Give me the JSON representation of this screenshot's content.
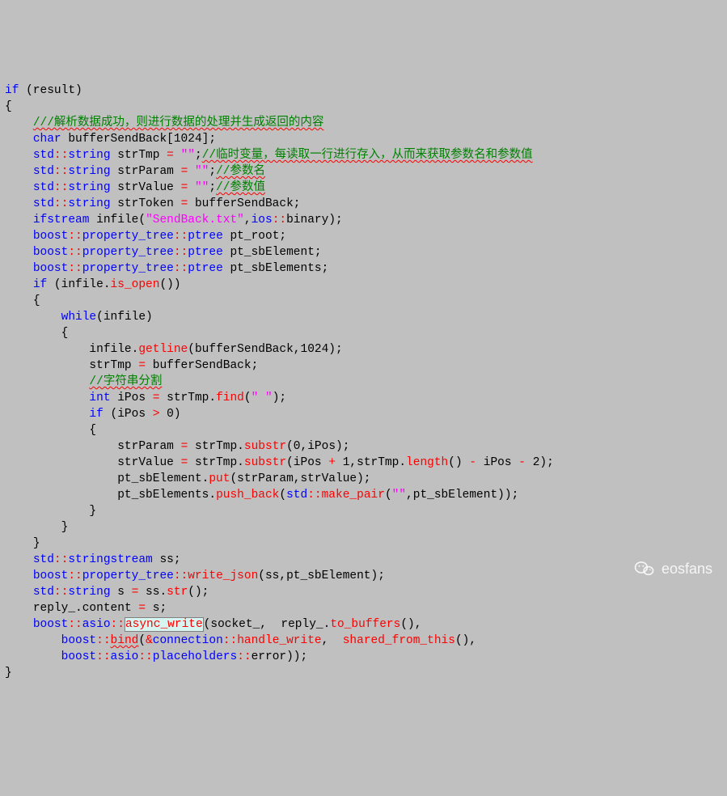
{
  "code": {
    "line1_if": "if",
    "line1_cond": " (result)",
    "line2_brace": "{",
    "line3_comment": "///解析数据成功，则进行数据的处理并生成返回的内容",
    "line4_char": "char",
    "line4_decl": " bufferSendBack[1024];",
    "line5_std": "std",
    "line5_dc1": "::",
    "line5_string": "string",
    "line5_var": " strTmp ",
    "line5_eq": "=",
    "line5_str": " \"\"",
    "line5_scolon": ";",
    "line5_comment": "//临时变量，每读取一行进行存入，从而来获取参数名和参数值",
    "line6_std": "std",
    "line6_dc1": "::",
    "line6_string": "string",
    "line6_var": " strParam ",
    "line6_eq": "=",
    "line6_str": " \"\"",
    "line6_scolon": ";",
    "line6_comment": "//参数名",
    "line7_std": "std",
    "line7_dc1": "::",
    "line7_string": "string",
    "line7_var": " strValue ",
    "line7_eq": "=",
    "line7_str": " \"\"",
    "line7_scolon": ";",
    "line7_comment": "//参数值",
    "line8_std": "std",
    "line8_dc1": "::",
    "line8_string": "string",
    "line8_var": " strToken ",
    "line8_eq": "=",
    "line8_rhs": " bufferSendBack;",
    "line9_ifstream": "ifstream",
    "line9_infile": " infile(",
    "line9_str": "\"SendBack.txt\"",
    "line9_comma": ",",
    "line9_ios": "ios",
    "line9_dc": "::",
    "line9_binary": "binary",
    "line9_close": ");",
    "line10_boost": "boost",
    "line10_dc1": "::",
    "line10_pt": "property_tree",
    "line10_dc2": "::",
    "line10_ptree": "ptree",
    "line10_var": " pt_root;",
    "line11_boost": "boost",
    "line11_dc1": "::",
    "line11_pt": "property_tree",
    "line11_dc2": "::",
    "line11_ptree": "ptree",
    "line11_var": " pt_sbElement;",
    "line12_boost": "boost",
    "line12_dc1": "::",
    "line12_pt": "property_tree",
    "line12_dc2": "::",
    "line12_ptree": "ptree",
    "line12_var": " pt_sbElements;",
    "line13_if": "if",
    "line13_open": " (infile.",
    "line13_isopen": "is_open",
    "line13_close": "())",
    "line14_brace": "{",
    "line15_while": "while",
    "line15_cond": "(infile)",
    "line16_brace": "{",
    "line17_infile": "infile.",
    "line17_getline": "getline",
    "line17_args": "(bufferSendBack,1024);",
    "line18_assign": "strTmp ",
    "line18_eq": "=",
    "line18_rhs": " bufferSendBack;",
    "line19_comment": "//字符串分割",
    "line20_int": "int",
    "line20_var": " iPos ",
    "line20_eq": "=",
    "line20_strtmp": " strTmp.",
    "line20_find": "find",
    "line20_open": "(",
    "line20_str": "\" \"",
    "line20_close": ");",
    "line21_if": "if",
    "line21_open": " (iPos ",
    "line21_gt": ">",
    "line21_zero": " 0)",
    "line22_brace": "{",
    "line23_lhs": "strParam ",
    "line23_eq": "=",
    "line23_strtmp": " strTmp.",
    "line23_substr": "substr",
    "line23_args": "(0,iPos);",
    "line24_lhs": "strValue ",
    "line24_eq": "=",
    "line24_strtmp": " strTmp.",
    "line24_substr": "substr",
    "line24_mid": "(iPos ",
    "line24_plus": "+",
    "line24_one": " 1,strTmp.",
    "line24_length": "length",
    "line24_paren": "() ",
    "line24_minus": "-",
    "line24_ipos": " iPos ",
    "line24_minus2": "-",
    "line24_two": " 2);",
    "line25_sb": "pt_sbElement.",
    "line25_put": "put",
    "line25_args": "(strParam,strValue);",
    "line26_sb": "pt_sbElements.",
    "line26_pushback": "push_back",
    "line26_open": "(",
    "line26_std": "std",
    "line26_dc": "::",
    "line26_makepair": "make_pair",
    "line26_open2": "(",
    "line26_str": "\"\"",
    "line26_close": ",pt_sbElement));",
    "line27_brace": "}",
    "line28_brace": "}",
    "line29_brace": "}",
    "line30_std": "std",
    "line30_dc": "::",
    "line30_ss": "stringstream",
    "line30_var": " ss;",
    "line31_boost": "boost",
    "line31_dc1": "::",
    "line31_pt": "property_tree",
    "line31_dc2": "::",
    "line31_writejson": "write_json",
    "line31_args": "(ss,pt_sbElement);",
    "line32_std": "std",
    "line32_dc": "::",
    "line32_string": "string",
    "line32_var": " s ",
    "line32_eq": "=",
    "line32_ss": " ss.",
    "line32_str": "str",
    "line32_close": "();",
    "line33_reply": "reply_.",
    "line33_content": "content",
    "line33_mid": " ",
    "line33_eq": "=",
    "line33_rhs": " s;",
    "line34_boost": "boost",
    "line34_dc1": "::",
    "line34_asio": "asio",
    "line34_dc2": "::",
    "line34_asyncwrite": "async_write",
    "line34_open": "(socket_,  reply_.",
    "line34_tobuffers": "to_buffers",
    "line34_close": "(),",
    "line35_boost": "boost",
    "line35_dc": "::",
    "line35_bind": "bind",
    "line35_open": "(",
    "line35_amp": "&",
    "line35_conn": "connection",
    "line35_dc2": "::",
    "line35_hw": "handle_write",
    "line35_comma": ",  ",
    "line35_sft": "shared_from_this",
    "line35_close": "(),",
    "line36_boost": "boost",
    "line36_dc1": "::",
    "line36_asio": "asio",
    "line36_dc2": "::",
    "line36_ph": "placeholders",
    "line36_dc3": "::",
    "line36_error": "error",
    "line36_close": "));",
    "line37_brace": "}",
    "ind1": "    ",
    "ind2": "        ",
    "ind3": "            ",
    "ind4": "                "
  },
  "watermark": {
    "text": "eosfans"
  }
}
